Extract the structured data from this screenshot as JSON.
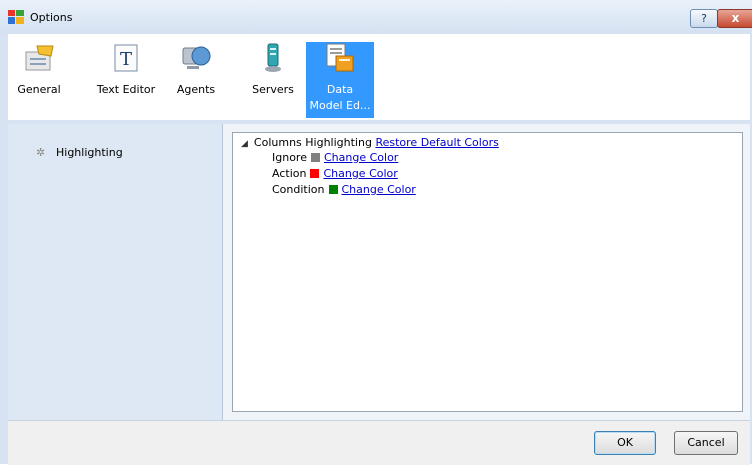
{
  "window": {
    "title": "Options",
    "help_label": "?",
    "close_label": "x"
  },
  "toolbar": {
    "items": [
      {
        "label": "General",
        "icon": "general-settings-icon"
      },
      {
        "label": "Text Editor",
        "icon": "text-editor-icon"
      },
      {
        "label": "Agents",
        "icon": "agents-icon"
      },
      {
        "label": "Servers",
        "icon": "servers-icon"
      },
      {
        "label": "Data Model Ed...",
        "label_line1": "Data",
        "label_line2": "Model Ed...",
        "icon": "data-model-icon",
        "selected": true
      }
    ]
  },
  "sidebar": {
    "items": [
      {
        "label": "Highlighting",
        "icon": "gear-icon"
      }
    ]
  },
  "tree": {
    "root_label": "Columns Highlighting",
    "restore_link": "Restore Default Colors",
    "rows": [
      {
        "label": "Ignore",
        "color": "#808080",
        "link": "Change Color"
      },
      {
        "label": "Action",
        "color": "#ff0000",
        "link": "Change Color"
      },
      {
        "label": "Condition",
        "color": "#008000",
        "link": "Change Color"
      }
    ]
  },
  "footer": {
    "ok_label": "OK",
    "cancel_label": "Cancel"
  }
}
